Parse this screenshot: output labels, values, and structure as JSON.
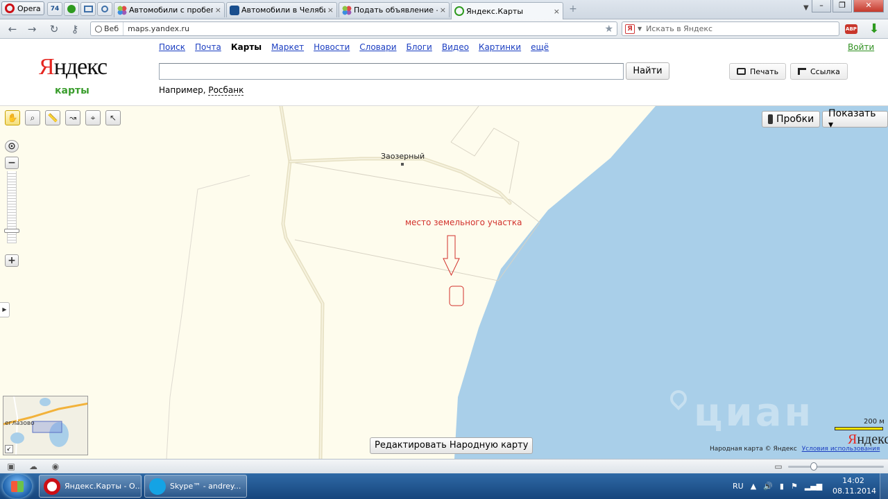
{
  "browser": {
    "menu_label": "Opera",
    "pinned": [
      "74"
    ],
    "tabs": [
      {
        "title": "Автомобили с пробег...",
        "close": "×"
      },
      {
        "title": "Автомобили в Челяби...",
        "close": "×"
      },
      {
        "title": "Подать объявление —...",
        "close": "×"
      },
      {
        "title": "Яндекс.Карты",
        "close": "×"
      }
    ],
    "web_badge": "Веб",
    "url": "maps.yandex.ru",
    "search_placeholder": "Искать в Яндекс",
    "search_engine_icon": "Я",
    "adblock_label": "ABP"
  },
  "header": {
    "logo": {
      "first_letter": "Я",
      "rest": "ндекс"
    },
    "logo_sub": "карты",
    "services": [
      "Поиск",
      "Почта",
      "Карты",
      "Маркет",
      "Новости",
      "Словари",
      "Блоги",
      "Видео",
      "Картинки",
      "ещё"
    ],
    "current_service": "Карты",
    "login": "Войти",
    "search_value": "",
    "find_button": "Найти",
    "example_prefix": "Например,",
    "example_link": "Росбанк",
    "print_button": "Печать",
    "link_button": "Ссылка"
  },
  "map": {
    "traffic_button": "Пробки",
    "show_button": "Показать ▾",
    "place_label": "Заозерный",
    "annotation": "место земельного участка",
    "minimap_label": "еглазово",
    "watermark": "циан",
    "edit_button": "Редактировать Народную карту",
    "scale_label": "200 м",
    "logo": {
      "first_letter": "Я",
      "rest": "ндекс"
    },
    "copyright": "Народная карта © Яндекс",
    "terms_link": "Условия использования",
    "colors": {
      "land": "#fefced",
      "water": "#a9cfe9",
      "road": "#e8e3c6",
      "annotation": "#d2312c"
    }
  },
  "taskbar": {
    "tasks": [
      {
        "label": "Яндекс.Карты - О...",
        "icon": "opera-icon"
      },
      {
        "label": "Skype™ - andrey...",
        "icon": "skype-icon"
      }
    ],
    "lang": "RU",
    "time": "14:02",
    "date": "08.11.2014"
  }
}
